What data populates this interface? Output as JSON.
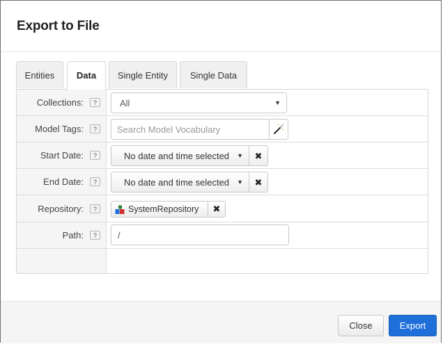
{
  "dialog": {
    "title": "Export to File"
  },
  "tabs": [
    {
      "label": "Entities",
      "active": false
    },
    {
      "label": "Data",
      "active": true
    },
    {
      "label": "Single Entity",
      "active": false
    },
    {
      "label": "Single Data",
      "active": false
    }
  ],
  "form": {
    "help_glyph": "?",
    "collections": {
      "label": "Collections:",
      "value": "All",
      "arrow": "▼"
    },
    "model_tags": {
      "label": "Model Tags:",
      "placeholder": "Search Model Vocabulary",
      "icon": "magic-wand-icon"
    },
    "start_date": {
      "label": "Start Date:",
      "value": "No date and time selected",
      "caret": "▼",
      "clear": "✖"
    },
    "end_date": {
      "label": "End Date:",
      "value": "No date and time selected",
      "caret": "▼",
      "clear": "✖"
    },
    "repository": {
      "label": "Repository:",
      "value": "SystemRepository",
      "clear": "✖",
      "icon": "repository-icon"
    },
    "path": {
      "label": "Path:",
      "value": "/"
    }
  },
  "footer": {
    "close_label": "Close",
    "export_label": "Export"
  },
  "colors": {
    "primary": "#1e6fd9",
    "label_bg": "#f5f5f5",
    "border": "#d6d6d6"
  }
}
